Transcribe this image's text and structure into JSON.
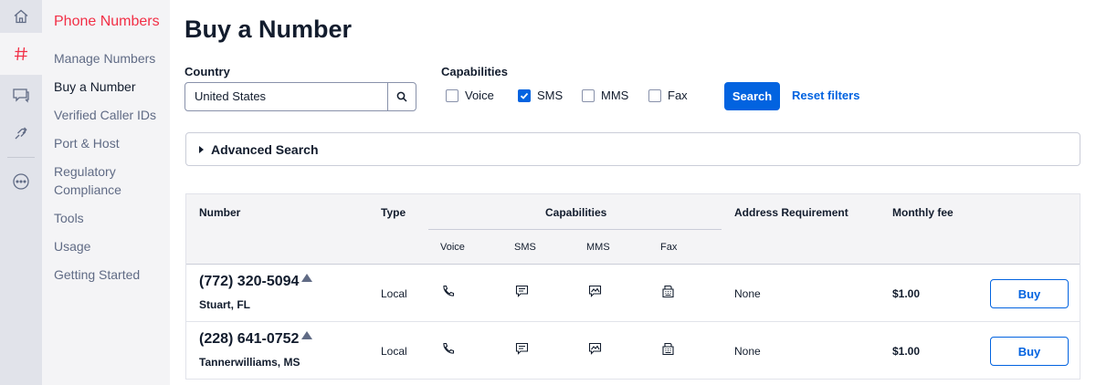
{
  "rail": {
    "items": [
      {
        "icon": "home-icon"
      },
      {
        "icon": "hash-icon"
      },
      {
        "icon": "chat-icon"
      },
      {
        "icon": "link-icon"
      },
      {
        "icon": "more-icon"
      }
    ]
  },
  "nav": {
    "title": "Phone Numbers",
    "items": [
      {
        "label": "Manage Numbers"
      },
      {
        "label": "Buy a Number"
      },
      {
        "label": "Verified Caller IDs"
      },
      {
        "label": "Port & Host"
      },
      {
        "label": "Regulatory Compliance"
      },
      {
        "label": "Tools"
      },
      {
        "label": "Usage"
      },
      {
        "label": "Getting Started"
      }
    ]
  },
  "page": {
    "title": "Buy a Number"
  },
  "filters": {
    "country_label": "Country",
    "country_value": "United States",
    "capabilities_label": "Capabilities",
    "capabilities": [
      {
        "label": "Voice",
        "checked": false
      },
      {
        "label": "SMS",
        "checked": true
      },
      {
        "label": "MMS",
        "checked": false
      },
      {
        "label": "Fax",
        "checked": false
      }
    ],
    "search_label": "Search",
    "reset_label": "Reset filters"
  },
  "advanced": {
    "label": "Advanced Search"
  },
  "table": {
    "headers": {
      "number": "Number",
      "type": "Type",
      "capabilities": "Capabilities",
      "address": "Address Requirement",
      "fee": "Monthly fee"
    },
    "sub_headers": {
      "voice": "Voice",
      "sms": "SMS",
      "mms": "MMS",
      "fax": "Fax"
    },
    "rows": [
      {
        "number": "(772) 320-5094",
        "location": "Stuart, FL",
        "type": "Local",
        "address": "None",
        "fee": "$1.00",
        "buy": "Buy"
      },
      {
        "number": "(228) 641-0752",
        "location": "Tannerwilliams, MS",
        "type": "Local",
        "address": "None",
        "fee": "$1.00",
        "buy": "Buy"
      }
    ]
  },
  "colors": {
    "brand_red": "#f22f46",
    "primary_blue": "#0263e0"
  }
}
